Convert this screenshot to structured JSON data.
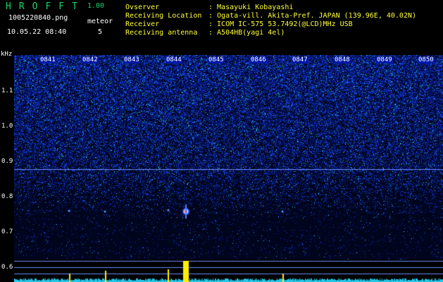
{
  "header": {
    "app_title": "HROFFT",
    "version": "1.00",
    "file_name": "1005220840.png",
    "meteor_label": "meteor",
    "datetime": "10.05.22 08:40",
    "meteor_count": "5",
    "info": [
      {
        "label": "Ovserver",
        "value": ": Masayuki Kobayashi"
      },
      {
        "label": "Receiving Location",
        "value": ": Ogata-vill. Akita-Pref. JAPAN (139.96E, 40.02N)"
      },
      {
        "label": "Receiver",
        "value": ": ICOM IC-575 53.7492(@LCD)MHz USB"
      },
      {
        "label": "Receiving antenna",
        "value": ": A504HB(yagi 4el)"
      }
    ]
  },
  "axis": {
    "unit": "kHz",
    "freq_ticks": [
      "1.1",
      "1.0",
      "0.9",
      "0.8",
      "0.7",
      "0.6"
    ],
    "time_ticks": [
      "0841",
      "0842",
      "0843",
      "0844",
      "0845",
      "0846",
      "0847",
      "0848",
      "0849",
      "0850"
    ]
  },
  "colors": {
    "background": "#000000",
    "header_text": "#ffffff",
    "title_green": "#17d46a",
    "info_yellow": "#ffff3a",
    "noise_blue": "#1030c8",
    "echo_red": "#ff2020",
    "signal_yellow": "#ffee00"
  }
}
